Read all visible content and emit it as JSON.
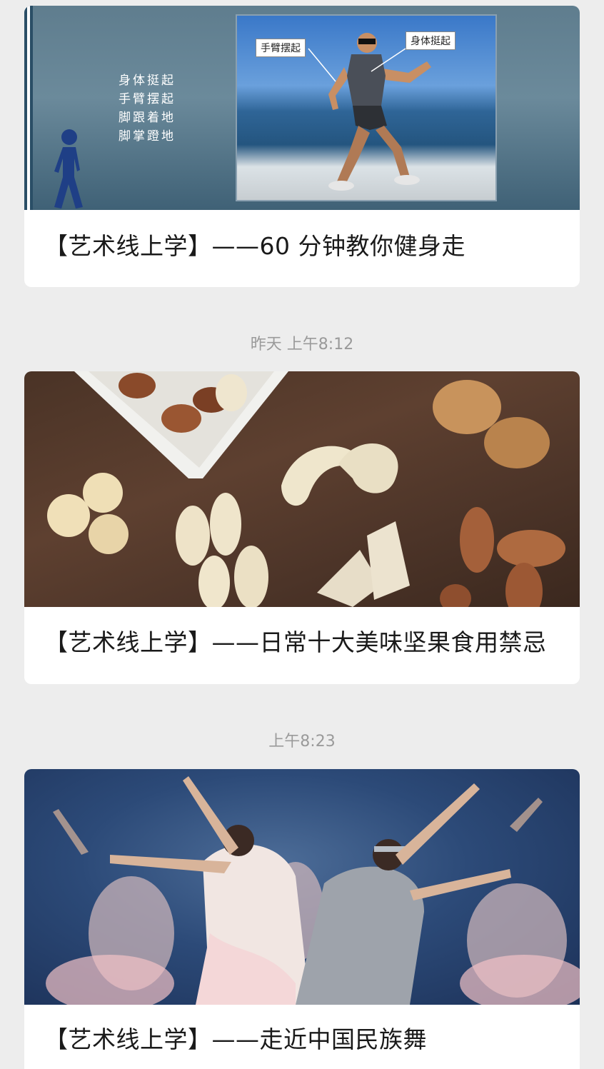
{
  "articles": [
    {
      "title": "【艺术线上学】——60 分钟教你健身走",
      "image": {
        "type": "fitness-walking",
        "overlay_lines": [
          "身体挺起",
          "手臂摆起",
          "脚跟着地",
          "脚掌蹬地"
        ],
        "tag_arm": "手臂摆起",
        "tag_body": "身体挺起"
      }
    },
    {
      "timestamp": "昨天 上午8:12",
      "title": "【艺术线上学】——日常十大美味坚果食用禁忌",
      "image": {
        "type": "nuts-on-wood-table"
      }
    },
    {
      "timestamp": "上午8:23",
      "title": "【艺术线上学】——走近中国民族舞",
      "image": {
        "type": "chinese-folk-dance-performance"
      }
    }
  ]
}
